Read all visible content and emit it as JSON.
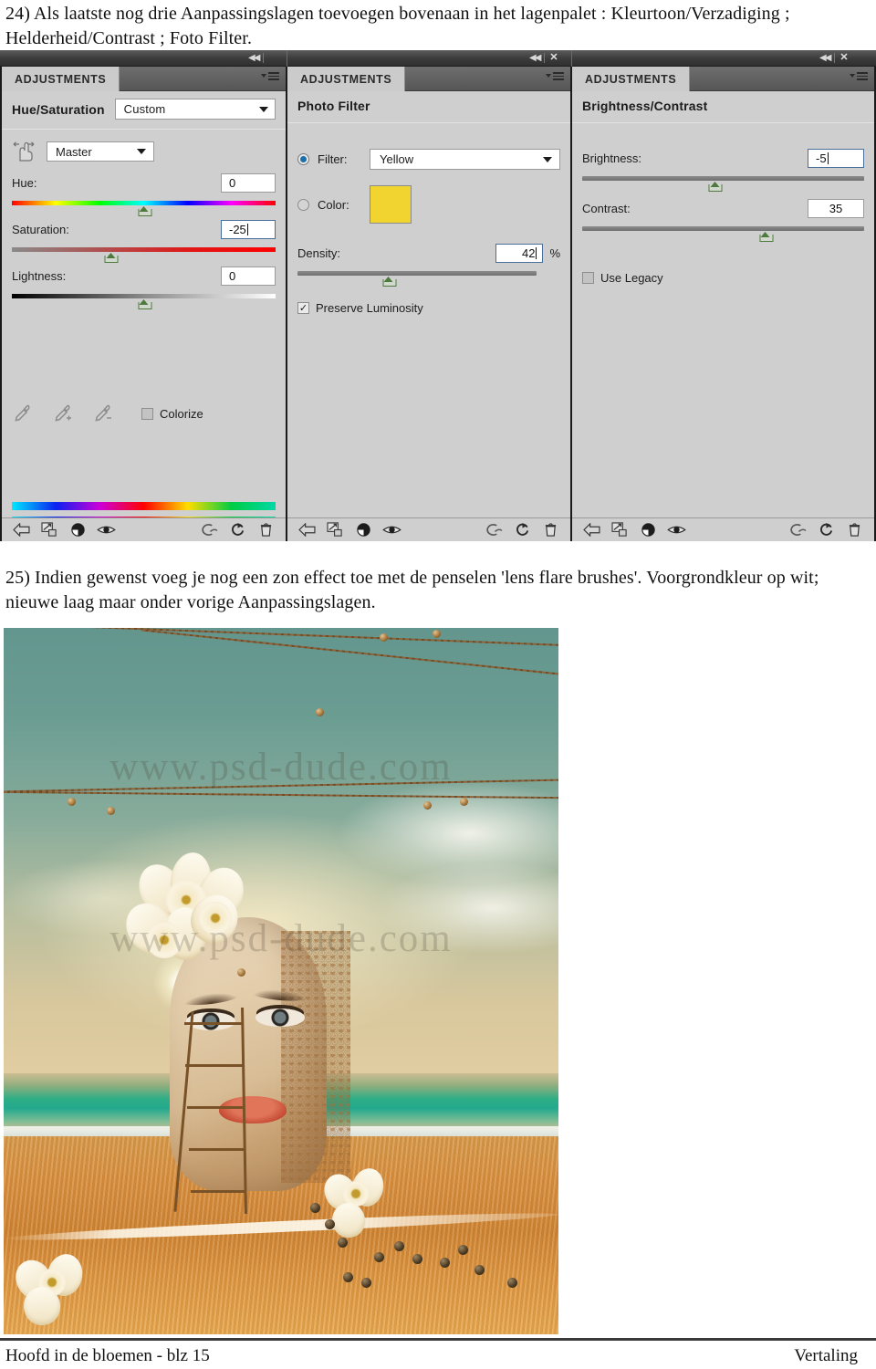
{
  "steps": {
    "step24": "24) Als laatste nog drie Aanpassingslagen toevoegen bovenaan in het lagenpalet : Kleurtoon/Verzadiging ; Helderheid/Contrast ; Foto Filter.",
    "step25": "25) Indien gewenst voeg je nog een zon effect toe met de penselen 'lens flare brushes'. Voorgrondkleur op wit; nieuwe laag maar onder vorige Aanpassingslagen."
  },
  "panels": {
    "hue_saturation": {
      "tab_label": "ADJUSTMENTS",
      "title": "Hue/Saturation",
      "preset": "Custom",
      "channel": "Master",
      "sliders": [
        {
          "label": "Hue:",
          "value": "0",
          "thumb_pct": 50,
          "focused": false
        },
        {
          "label": "Saturation:",
          "value": "-25",
          "thumb_pct": 37.5,
          "focused": true
        },
        {
          "label": "Lightness:",
          "value": "0",
          "thumb_pct": 50,
          "focused": false
        }
      ],
      "colorize_label": "Colorize",
      "colorize_checked": false
    },
    "photo_filter": {
      "tab_label": "ADJUSTMENTS",
      "title": "Photo Filter",
      "filter_label": "Filter:",
      "filter_value": "Yellow",
      "filter_selected": true,
      "color_label": "Color:",
      "color_selected": false,
      "color_swatch": "#f2d430",
      "density_label": "Density:",
      "density_value": "42",
      "density_unit": "%",
      "density_pct": 38,
      "preserve_label": "Preserve Luminosity",
      "preserve_checked": true
    },
    "brightness_contrast": {
      "tab_label": "ADJUSTMENTS",
      "title": "Brightness/Contrast",
      "sliders": [
        {
          "label": "Brightness:",
          "value": "-5",
          "thumb_pct": 47,
          "focused": true
        },
        {
          "label": "Contrast:",
          "value": "35",
          "thumb_pct": 65,
          "focused": false
        }
      ],
      "legacy_label": "Use Legacy",
      "legacy_checked": false
    },
    "footer_icons": [
      "back-arrow-icon",
      "clip-to-layer-icon",
      "view-adjustment-icon",
      "toggle-visibility-icon",
      "view-previous-state-icon",
      "reset-adjustment-icon",
      "delete-adjustment-icon"
    ]
  },
  "artwork": {
    "watermark": "www.psd-dude.com"
  },
  "footer": {
    "left": "Hoofd in de bloemen - blz 15",
    "right": "Vertaling"
  }
}
